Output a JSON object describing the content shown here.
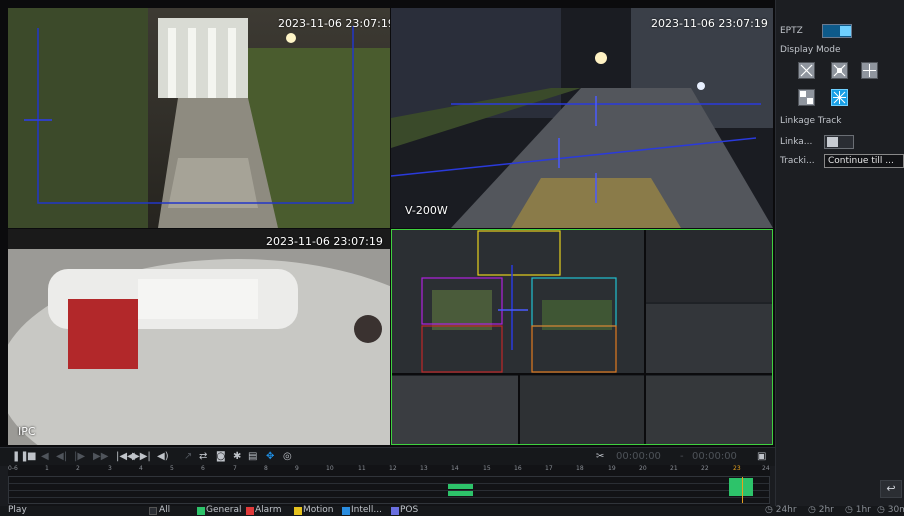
{
  "channels": [
    {
      "timestamp": "2023-11-06 23:07:19",
      "label": ""
    },
    {
      "timestamp": "2023-11-06 23:07:19",
      "label": "V-200W"
    },
    {
      "timestamp": "2023-11-06 23:07:19",
      "label": "IPC"
    },
    {
      "timestamp": "",
      "label": ""
    }
  ],
  "eptz_panel": {
    "eptz_label": "EPTZ",
    "eptz_on": true,
    "display_mode_label": "Display Mode",
    "display_modes": [
      "mode-1",
      "mode-2",
      "mode-3",
      "mode-4",
      "mode-5"
    ],
    "active_mode_index": 4,
    "linkage_track_label": "Linkage Track",
    "linkage_label": "Linka...",
    "linkage_on": false,
    "tracking_label": "Tracki...",
    "tracking_value": "Continue till ..."
  },
  "playback": {
    "time_start_placeholder": "00:00:00",
    "time_end_placeholder": "00:00:00",
    "time_separator": "-"
  },
  "timeline": {
    "ticks": [
      "0-6",
      "1",
      "2",
      "3",
      "4",
      "5",
      "6",
      "7",
      "8",
      "9",
      "10",
      "11",
      "12",
      "13",
      "14",
      "15",
      "16",
      "17",
      "18",
      "19",
      "20",
      "21",
      "22",
      "23",
      "24"
    ],
    "current_marker": "23"
  },
  "status": {
    "mode": "Play",
    "filters": [
      {
        "label": "All",
        "color": "#2a2d33"
      },
      {
        "label": "General",
        "color": "#2dc36a"
      },
      {
        "label": "Alarm",
        "color": "#e03a3a"
      },
      {
        "label": "Motion",
        "color": "#e6c21e"
      },
      {
        "label": "Intell...",
        "color": "#2a8de0"
      },
      {
        "label": "POS",
        "color": "#6a6fe0"
      }
    ],
    "zooms": [
      "24hr",
      "2hr",
      "1hr",
      "30m"
    ]
  },
  "colors": {
    "accent": "#19a0e6",
    "panel": "#1c1e22"
  }
}
